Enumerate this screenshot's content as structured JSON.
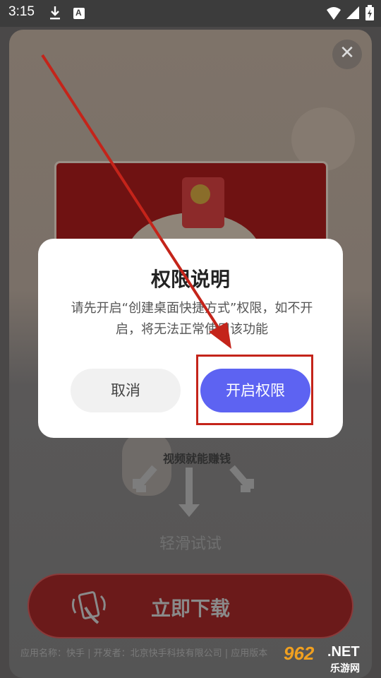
{
  "status_bar": {
    "time": "3:15",
    "icons": [
      "download-icon",
      "a-icon",
      "wifi-icon",
      "signal-icon",
      "battery-icon"
    ]
  },
  "background": {
    "close_icon": "close-icon",
    "video_text": "视频就能赚钱",
    "swipe_hint": "轻滑试试",
    "download_button": "立即下载",
    "footer": "应用名称：快手 | 开发者：北京快手科技有限公司 | 应用版本"
  },
  "dialog": {
    "title": "权限说明",
    "message": "请先开启“创建桌面快捷方式”权限，如不开启，将无法正常使用该功能",
    "cancel_label": "取消",
    "confirm_label": "开启权限"
  },
  "annotation": {
    "color": "#c4241a"
  },
  "watermark": {
    "number": "962",
    "suffix": ".NET",
    "site": "乐游网"
  },
  "colors": {
    "confirm_button": "#5d63f2",
    "cancel_button": "#f1f1f1",
    "status_bar": "#3c3c3c"
  }
}
